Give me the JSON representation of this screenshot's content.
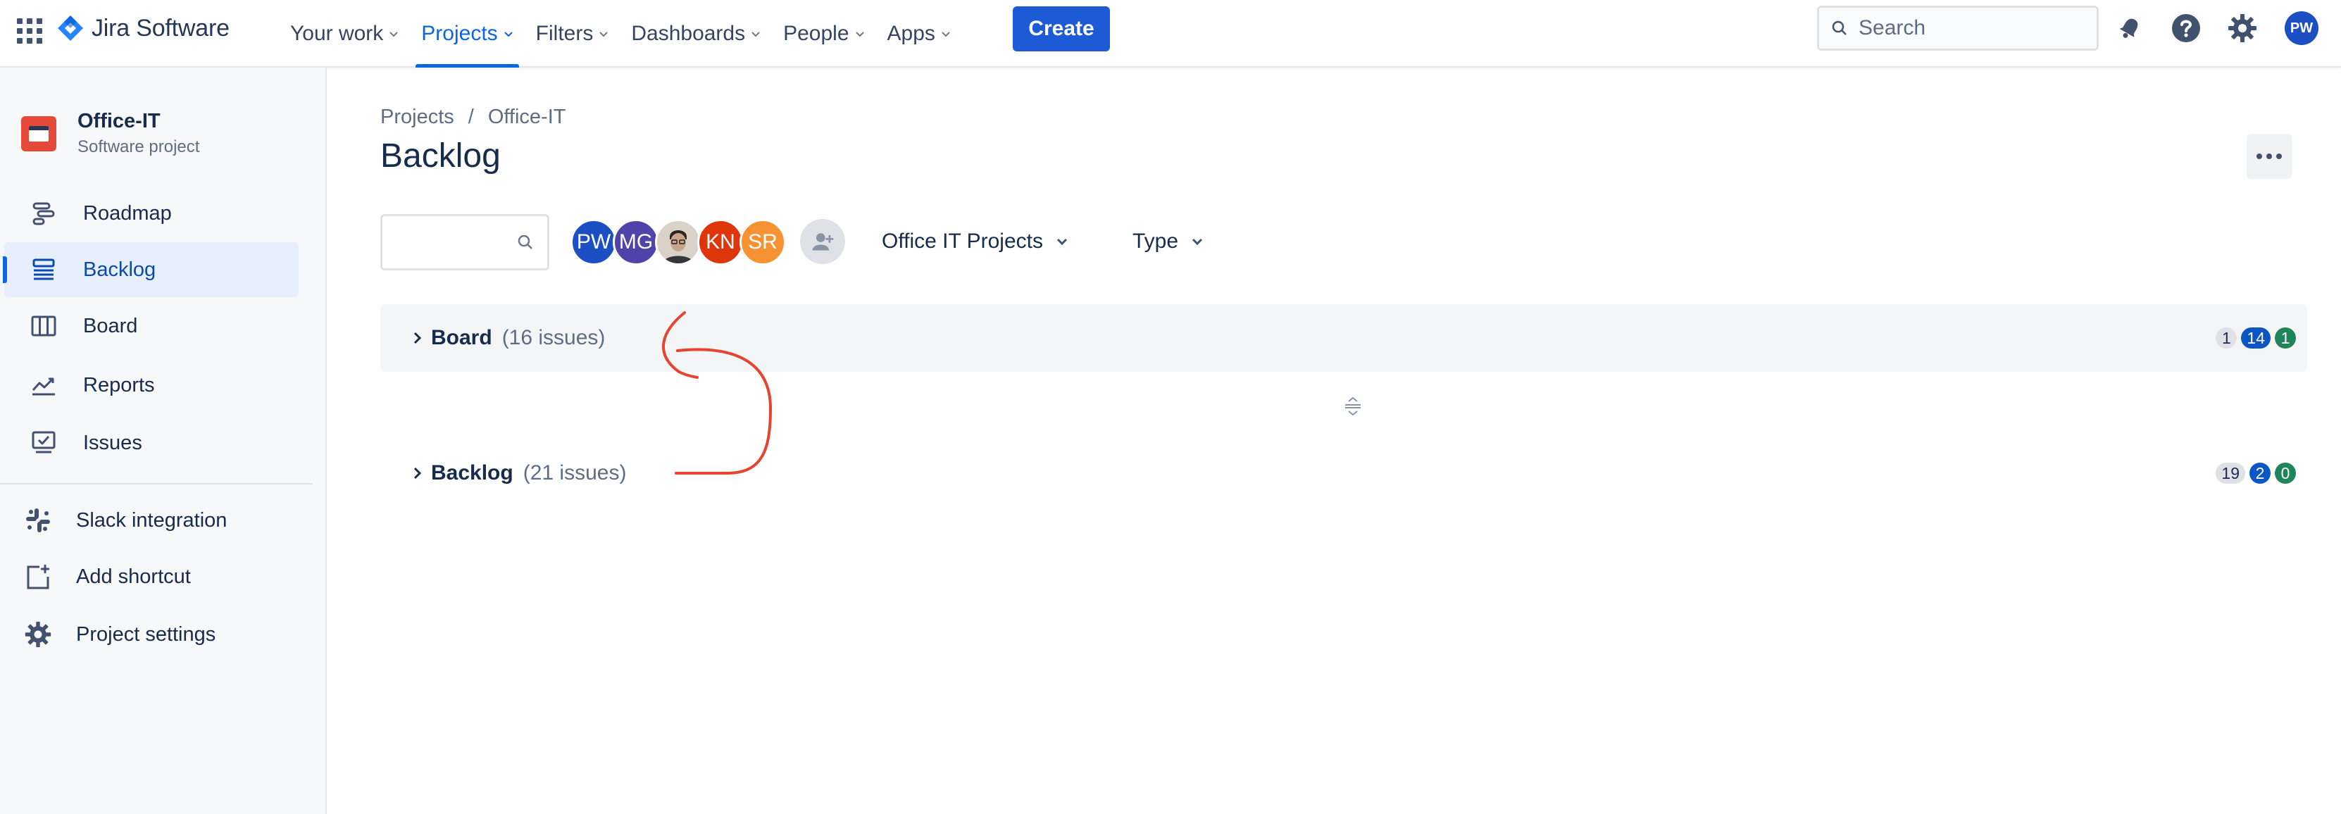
{
  "topnav": {
    "logo_text": "Jira Software",
    "items": [
      {
        "label": "Your work"
      },
      {
        "label": "Projects"
      },
      {
        "label": "Filters"
      },
      {
        "label": "Dashboards"
      },
      {
        "label": "People"
      },
      {
        "label": "Apps"
      }
    ],
    "active_item": "Projects",
    "create_label": "Create",
    "search_placeholder": "Search",
    "user_initials": "PW"
  },
  "sidebar": {
    "project_name": "Office-IT",
    "project_type": "Software project",
    "items": [
      {
        "label": "Roadmap",
        "icon": "roadmap-icon"
      },
      {
        "label": "Backlog",
        "icon": "backlog-icon"
      },
      {
        "label": "Board",
        "icon": "board-icon"
      },
      {
        "label": "Reports",
        "icon": "reports-icon"
      },
      {
        "label": "Issues",
        "icon": "issues-icon"
      }
    ],
    "active_item": "Backlog",
    "secondary_items": [
      {
        "label": "Slack integration",
        "icon": "slack-icon"
      },
      {
        "label": "Add shortcut",
        "icon": "add-shortcut-icon"
      },
      {
        "label": "Project settings",
        "icon": "gear-icon"
      }
    ]
  },
  "main": {
    "breadcrumb": {
      "root": "Projects",
      "separator": "/",
      "current": "Office-IT"
    },
    "title": "Backlog",
    "avatars": [
      {
        "initials": "PW",
        "color": "#1d4fc4"
      },
      {
        "initials": "MG",
        "color": "#5243aa"
      },
      {
        "initials": "",
        "color": "#e8e8e8"
      },
      {
        "initials": "KN",
        "color": "#de350b"
      },
      {
        "initials": "SR",
        "color": "#f79232"
      }
    ],
    "filters": {
      "epic_label": "Office IT Projects",
      "type_label": "Type"
    },
    "sprints": [
      {
        "name": "Board",
        "count": "(16 issues)",
        "todo": "1",
        "in_progress": "14",
        "done": "1"
      },
      {
        "name": "Backlog",
        "count": "(21 issues)",
        "todo": "19",
        "in_progress": "2",
        "done": "0"
      }
    ]
  },
  "colors": {
    "brand": "#1d5bd6",
    "active_nav": "#0c66e4",
    "annotation": "#e5442f",
    "badge_progress": "#0c55c4",
    "badge_done": "#1f845a"
  }
}
